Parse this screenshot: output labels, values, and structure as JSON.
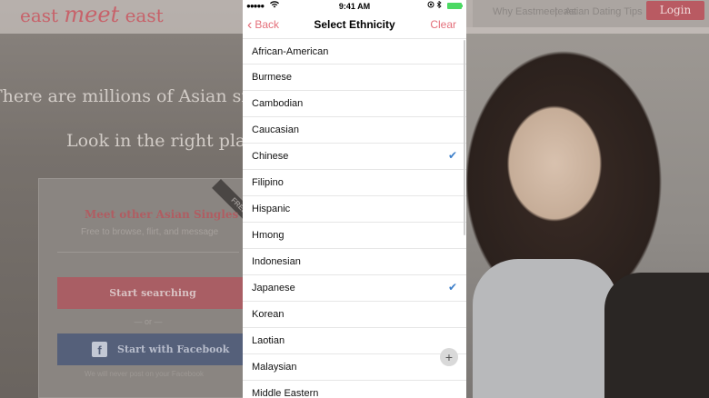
{
  "site": {
    "logo_left": "east",
    "logo_mid": "meet",
    "logo_right": "east",
    "nav": [
      "Why Eastmeeteast",
      "Asian Dating Tips"
    ],
    "nav_separator": "|",
    "login_label": "Login",
    "hero_line1": "There are millions of Asian singles",
    "hero_line2": "Look in the right place.",
    "card": {
      "ribbon": "FREE",
      "title": "Meet other Asian Singles",
      "subtitle": "Free to browse, flirt, and message",
      "start_label": "Start searching",
      "or_text": "— or —",
      "facebook_icon": "f",
      "facebook_label": "Start with Facebook",
      "footer": "We will never post on your Facebook"
    }
  },
  "modal": {
    "status": {
      "signal": "●●●●●",
      "wifi": "wifi-icon",
      "time": "9:41 AM",
      "location": "location-icon",
      "bluetooth": "bluetooth-icon"
    },
    "nav": {
      "back_icon": "‹",
      "back_label": "Back",
      "title": "Select Ethnicity",
      "clear_label": "Clear"
    },
    "items": [
      {
        "label": "African-American",
        "selected": false
      },
      {
        "label": "Burmese",
        "selected": false
      },
      {
        "label": "Cambodian",
        "selected": false
      },
      {
        "label": "Caucasian",
        "selected": false
      },
      {
        "label": "Chinese",
        "selected": true
      },
      {
        "label": "Filipino",
        "selected": false
      },
      {
        "label": "Hispanic",
        "selected": false
      },
      {
        "label": "Hmong",
        "selected": false
      },
      {
        "label": "Indonesian",
        "selected": false
      },
      {
        "label": "Japanese",
        "selected": true
      },
      {
        "label": "Korean",
        "selected": false
      },
      {
        "label": "Laotian",
        "selected": false
      },
      {
        "label": "Malaysian",
        "selected": false
      },
      {
        "label": "Middle Eastern",
        "selected": false
      }
    ],
    "check_glyph": "✔",
    "fab_glyph": "+"
  },
  "colors": {
    "accent": "#e46f7a",
    "check": "#3b7ec9",
    "battery": "#4cd964"
  }
}
